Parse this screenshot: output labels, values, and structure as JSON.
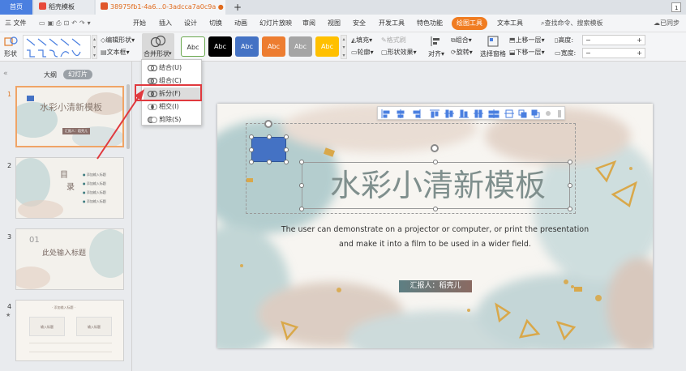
{
  "tabs": {
    "home": "首页",
    "template": "稻壳模板",
    "doc": "38975fb1-4a6...0-3adcca7a0c9a",
    "add": "+",
    "counter": "1"
  },
  "menu": {
    "file": "三 文件",
    "items": [
      "开始",
      "插入",
      "设计",
      "切换",
      "动画",
      "幻灯片放映",
      "审阅",
      "视图",
      "安全",
      "开发工具",
      "特色功能",
      "绘图工具",
      "文本工具"
    ],
    "search": "查找命令、搜索模板",
    "sync": "已同步"
  },
  "ribbon": {
    "shape_label": "形状",
    "edit_shape": "编辑形状",
    "text_box": "文本框",
    "merge_shape": "合并形状",
    "style_label": "Abc",
    "fill": "填充",
    "format_brush": "格式刷",
    "outline": "轮廓",
    "shape_effect": "形状效果",
    "align": "对齐",
    "group": "组合",
    "rotate": "旋转",
    "selection_pane": "选择窗格",
    "bring_forward": "上移一层",
    "send_backward": "下移一层",
    "height": "高度:",
    "width": "宽度:",
    "minus": "−",
    "plus": "+"
  },
  "colors": {
    "accent": "#f07c21",
    "swatches": [
      "#ffffff",
      "#000000",
      "#4472c4",
      "#ed7d31",
      "#a5a5a5",
      "#ffc000"
    ]
  },
  "merge_menu": {
    "items": [
      "结合(U)",
      "组合(C)",
      "拆分(F)",
      "相交(I)",
      "剪除(S)"
    ],
    "highlighted": "拆分(F)"
  },
  "panel": {
    "outline_tab": "大纲",
    "slides_tab": "幻灯片",
    "slides": [
      {
        "number": "1",
        "title": "水彩小清新模板",
        "tag": "汇报人：稻壳儿"
      },
      {
        "number": "2",
        "title": "目",
        "title2": "录",
        "items": [
          "添加输入标题",
          "添加输入标题",
          "添加输入标题",
          "添加输入标题"
        ]
      },
      {
        "number": "3",
        "section": "01",
        "title": "此处输入标题"
      },
      {
        "number": "4",
        "header": "· 添加输入标题 ·",
        "cards": [
          "输入标题",
          "输入标题"
        ]
      }
    ]
  },
  "slide": {
    "title": "水彩小清新模板",
    "subtitle_line1": "The user can demonstrate on a projector or computer, or print the presentation",
    "subtitle_line2": "and make it into a film to be used in a wider field.",
    "reporter": "汇报人：稻壳儿"
  }
}
